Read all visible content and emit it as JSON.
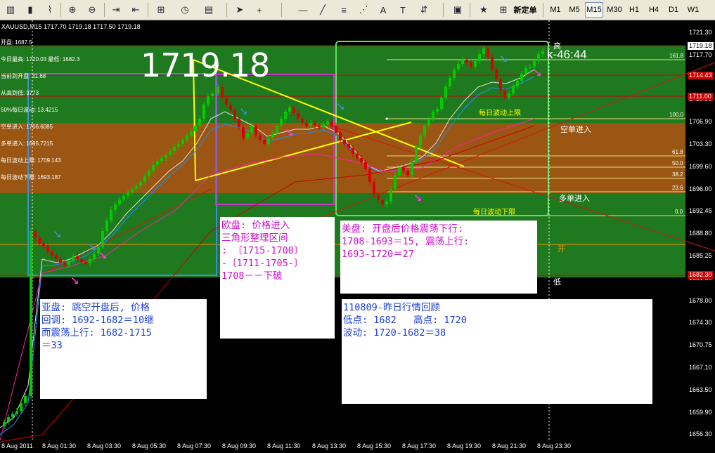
{
  "toolbar": {
    "new_order_label": "新定单",
    "timeframes": [
      "M1",
      "M5",
      "M15",
      "M30",
      "H1",
      "H4",
      "D1",
      "W1"
    ],
    "active_timeframe": "M15"
  },
  "chart": {
    "symbol_line": "XAUUSD,M15  1717.70 1719.18 1717.50 1719.18",
    "big_price": "1719.18",
    "countdown": "k-46:44",
    "stats": [
      {
        "label": "开盘:",
        "value": "1687.5"
      },
      {
        "label": "今日最高:",
        "value": "1720.03  最低: 1682.3"
      },
      {
        "label": "当前到开盘:",
        "value": "31.68"
      },
      {
        "label": "从高到低:",
        "value": "3773"
      },
      {
        "label": "50%每日波动:",
        "value": "13.4215"
      },
      {
        "label": "空单进入:",
        "value": "1706.6085"
      },
      {
        "label": "多单进入:",
        "value": "1695.7215"
      },
      {
        "label": "每日波动上限:",
        "value": "1709.143"
      },
      {
        "label": "每日波动下限:",
        "value": "1693.187"
      }
    ],
    "y_axis": [
      "1721.30",
      "1717.70",
      "1714.15",
      "1710.55",
      "1706.90",
      "1703.30",
      "1699.60",
      "1696.00",
      "1692.45",
      "1688.80",
      "1685.25",
      "1681.60",
      "1678.00",
      "1674.30",
      "1670.75",
      "1667.10",
      "1663.50",
      "1659.90",
      "1656.30"
    ],
    "x_axis": [
      "8 Aug 2011",
      "8 Aug 01:30",
      "8 Aug 03:30",
      "8 Aug 05:30",
      "8 Aug 07:30",
      "8 Aug 09:30",
      "8 Aug 11:30",
      "8 Aug 13:30",
      "8 Aug 15:30",
      "8 Aug 17:30",
      "8 Aug 19:30",
      "8 Aug 21:30",
      "8 Aug 23:30"
    ],
    "price_tags": [
      {
        "text": "1719.18",
        "bg": "#ffffff",
        "fg": "#000000"
      },
      {
        "text": "1714.43",
        "bg": "#cc0000",
        "fg": "#ffffff"
      },
      {
        "text": "1711.00",
        "bg": "#cc0000",
        "fg": "#ffffff"
      },
      {
        "text": "1682.30",
        "bg": "#cc0000",
        "fg": "#ffffff"
      }
    ],
    "fib_levels": [
      "161.8",
      "100.0",
      "61.8",
      "50.0",
      "38.2",
      "23.6",
      "0.0"
    ],
    "level_labels": {
      "high": "高",
      "short_entry": "空单进入",
      "long_entry": "多单进入",
      "open": "开",
      "low": "低",
      "daily_upper": "每日波动上限",
      "daily_lower": "每日波动下限"
    },
    "colors": {
      "bull": "#00cc00",
      "bear": "#dd0000",
      "green_zone": "#1f7a1f",
      "brown_zone": "#9a5612",
      "asia_box": "#3b8fd6",
      "europe_box": "#cc33cc",
      "us_box": "#66dd66",
      "triangle": "#ffff00"
    }
  },
  "notes": {
    "asia": "亚盘: 跳空开盘后, 价格\n回调: 1692-1682＝10继\n而震荡上行: 1682-1715\n＝33",
    "europe": "欧盘: 价格进入\n三角形整理区间\n: 〔1715-1700〕\n-〔1711-1705-〕\n1708－－下破",
    "us": "美盘: 开盘后价格震荡下行:\n1708-1693＝15, 震荡上行:\n1693-1720＝27",
    "review": "110809-昨日行情回顾\n低点: 1682   高点: 1720\n波动: 1720-1682＝38"
  }
}
